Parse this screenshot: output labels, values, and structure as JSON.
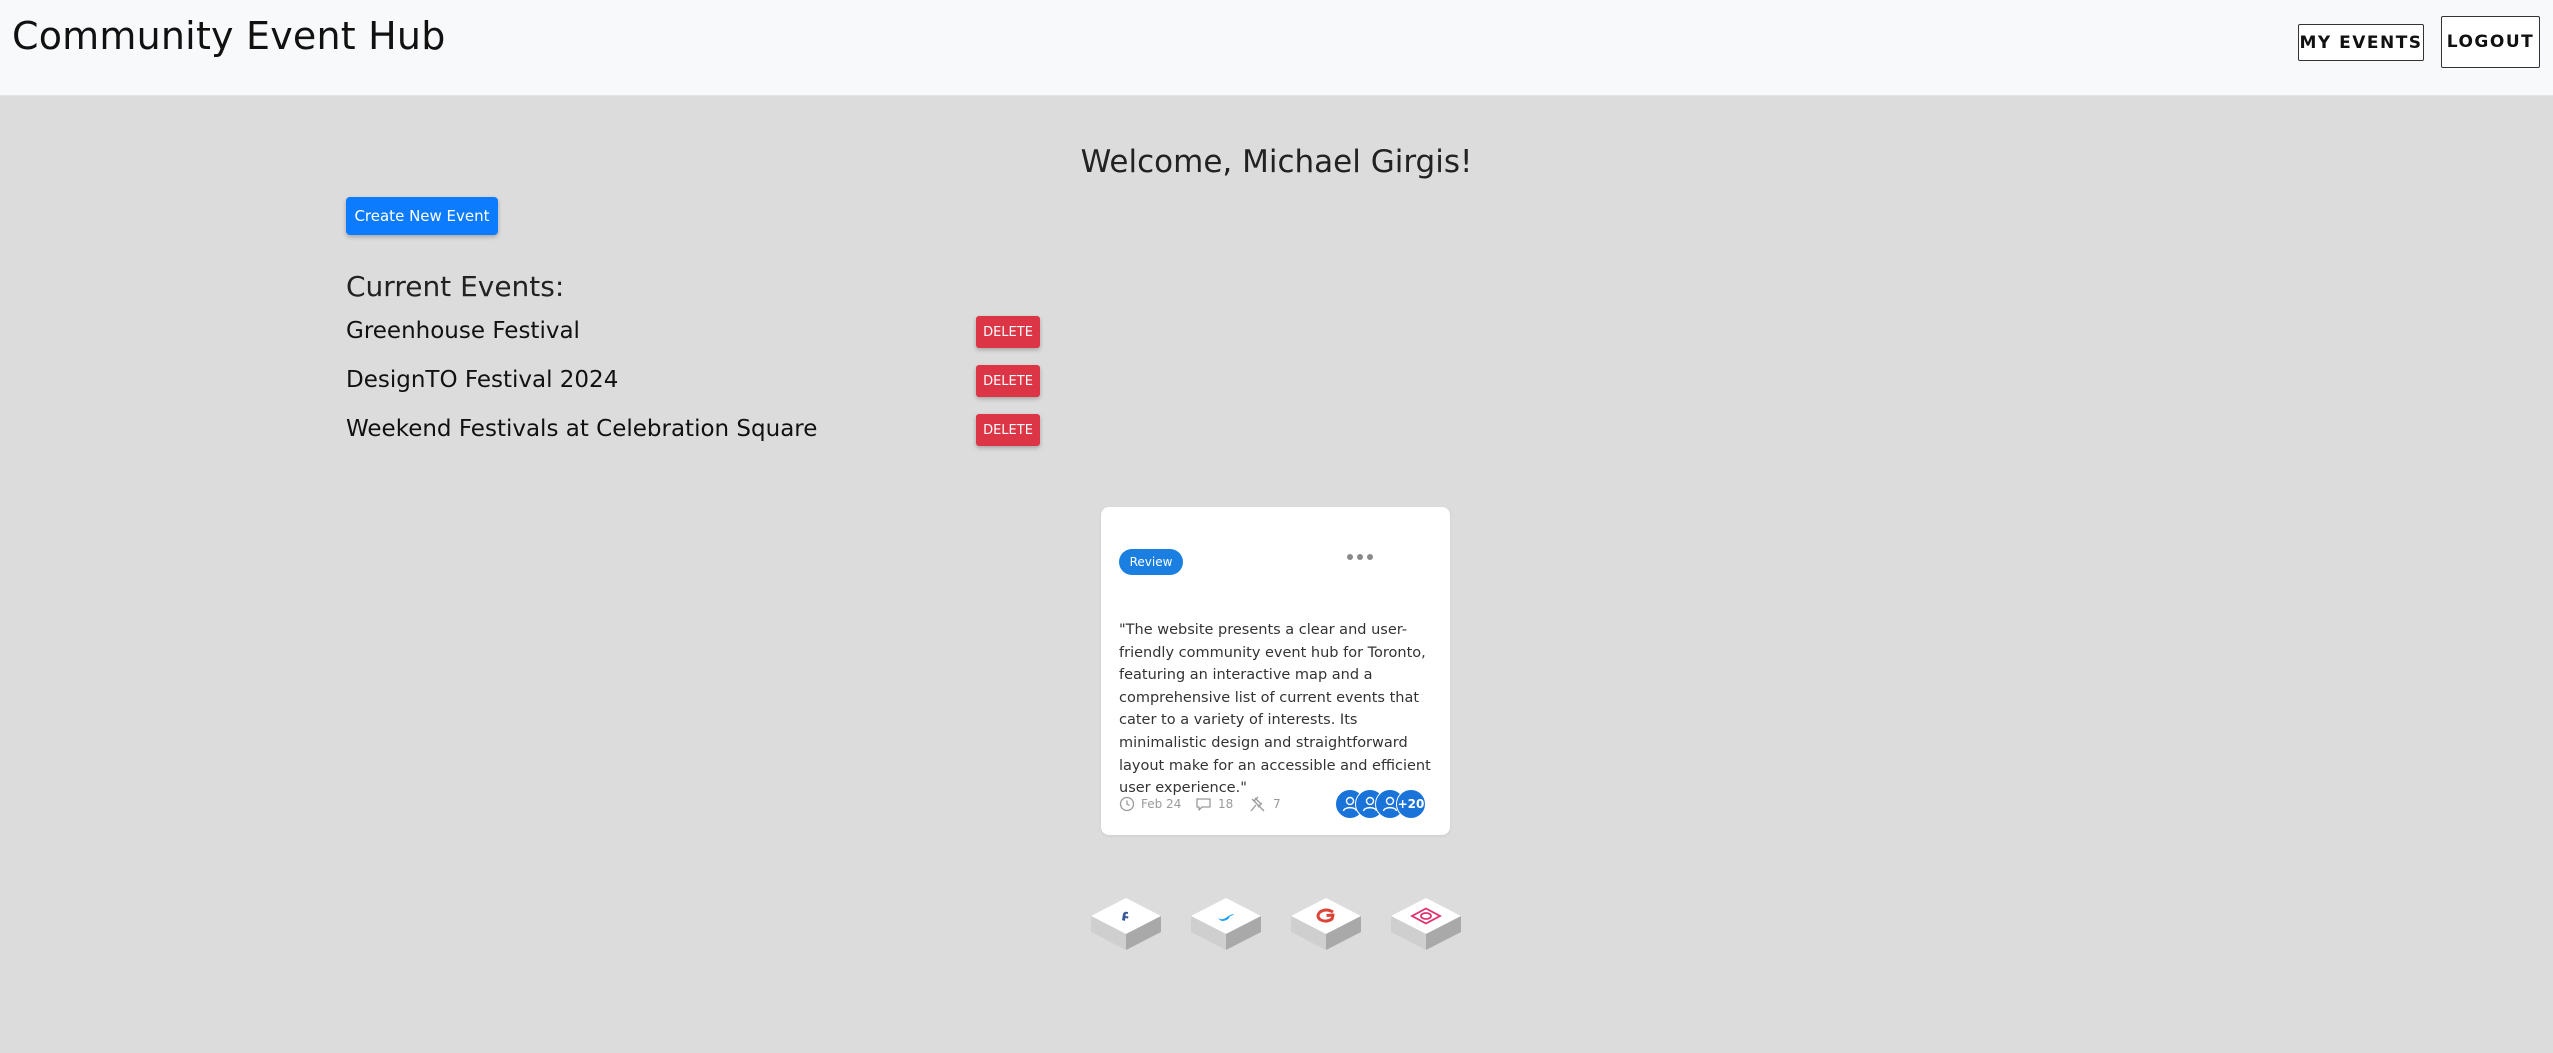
{
  "header": {
    "title": "Community Event Hub",
    "my_events_label": "MY EVENTS",
    "logout_label": "LOGOUT"
  },
  "main": {
    "welcome": "Welcome, Michael Girgis!",
    "create_label": "Create New Event",
    "current_title": "Current Events:",
    "delete_label": "DELETE",
    "events": [
      {
        "name": "Greenhouse Festival"
      },
      {
        "name": "DesignTO Festival 2024"
      },
      {
        "name": "Weekend Festivals at Celebration Square"
      }
    ]
  },
  "review_card": {
    "badge": "Review",
    "text": "\"The website presents a clear and user-friendly community event hub for Toronto, featuring an interactive map and a comprehensive list of current events that cater to a variety of interests. Its minimalistic design and straightforward layout make for an accessible and efficient user experience.\"",
    "date": "Feb 24",
    "comments": "18",
    "pins": "7",
    "more_count": "+20"
  },
  "social": [
    {
      "icon": "facebook-icon",
      "color": "#3b5998"
    },
    {
      "icon": "twitter-icon",
      "color": "#1da1f2"
    },
    {
      "icon": "google-icon",
      "color": "#db4437"
    },
    {
      "icon": "instagram-icon",
      "color": "#e1306c"
    }
  ],
  "colors": {
    "background": "#dcdcdc",
    "header": "#f8f9fa",
    "primary": "#0d7bfd",
    "danger": "#dc3545",
    "badge": "#1a7fe0"
  }
}
